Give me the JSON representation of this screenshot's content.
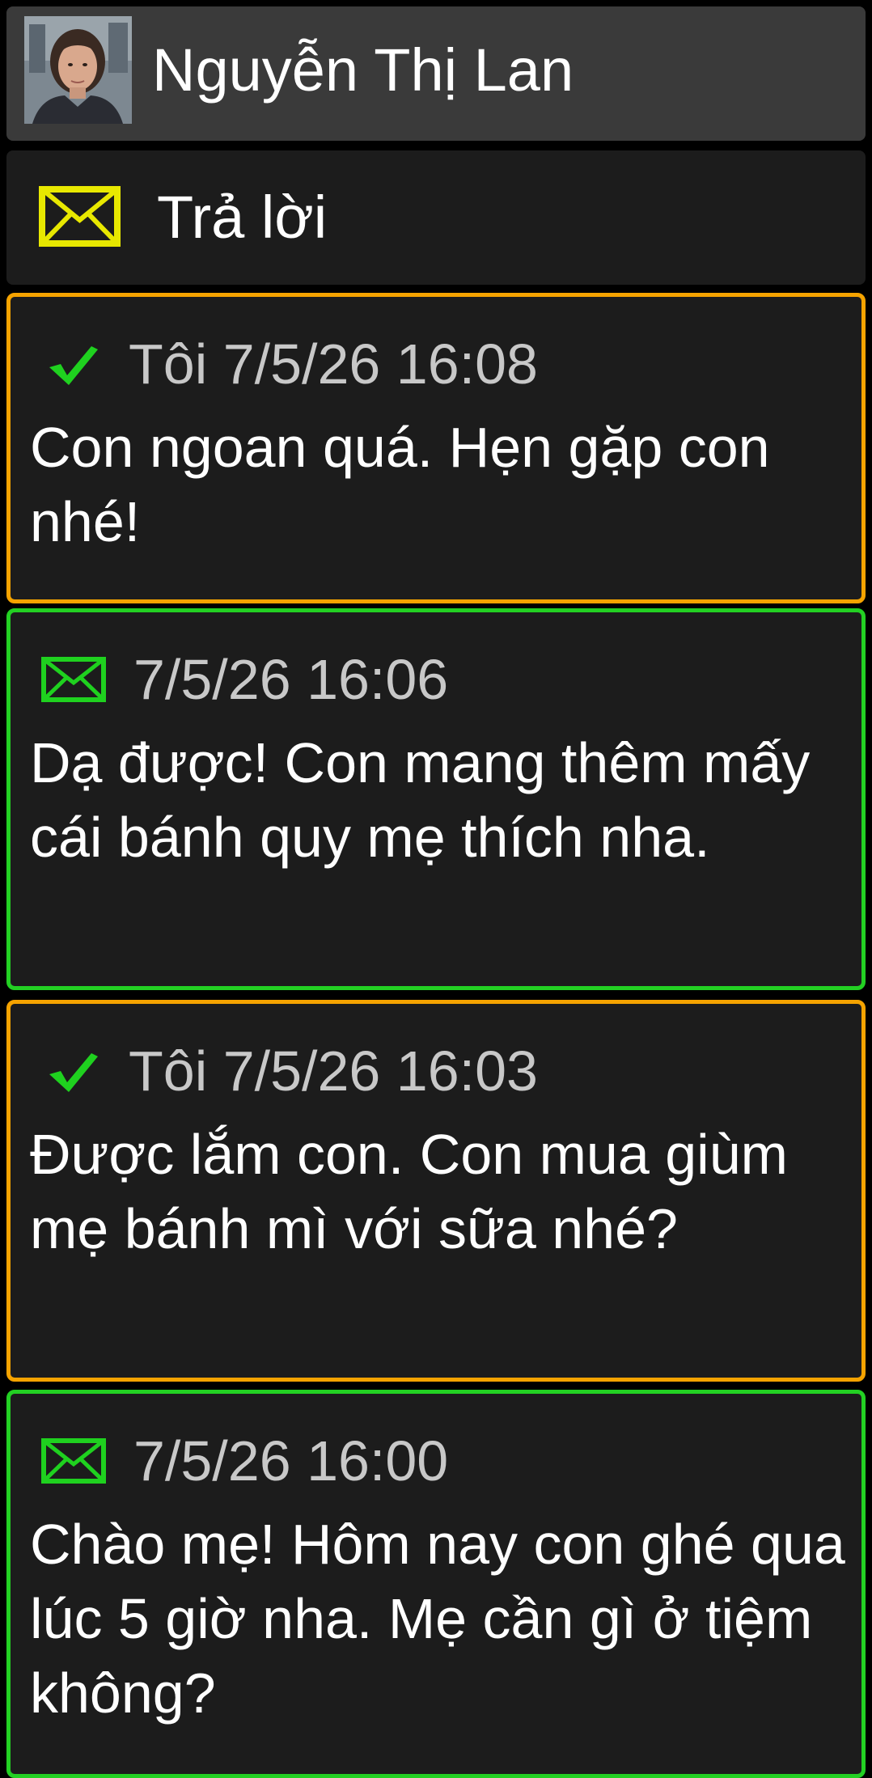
{
  "header": {
    "contact_name": "Nguyễn Thị Lan",
    "avatar_icon": "contact-photo"
  },
  "reply": {
    "label": "Trả lời",
    "icon": "envelope-icon",
    "icon_color": "#e8e800"
  },
  "colors": {
    "sent_border": "#f5a300",
    "received_border": "#23d023",
    "sent_icon": "#1fd11f",
    "received_icon": "#1fd11f"
  },
  "messages": [
    {
      "direction": "sent",
      "status_icon": "check-icon",
      "meta": "Tôi 7/5/26 16:08",
      "text": "Con ngoan quá. Hẹn gặp con nhé!"
    },
    {
      "direction": "received",
      "status_icon": "envelope-icon",
      "meta": "7/5/26 16:06",
      "text": "Dạ được! Con mang thêm mấy cái bánh quy mẹ thích nha."
    },
    {
      "direction": "sent",
      "status_icon": "check-icon",
      "meta": "Tôi 7/5/26 16:03",
      "text": "Được lắm con. Con mua giùm mẹ bánh mì với sữa nhé?"
    },
    {
      "direction": "received",
      "status_icon": "envelope-icon",
      "meta": "7/5/26 16:00",
      "text": "Chào mẹ! Hôm nay con ghé qua lúc 5 giờ nha. Mẹ cần gì ở tiệm không?"
    }
  ]
}
